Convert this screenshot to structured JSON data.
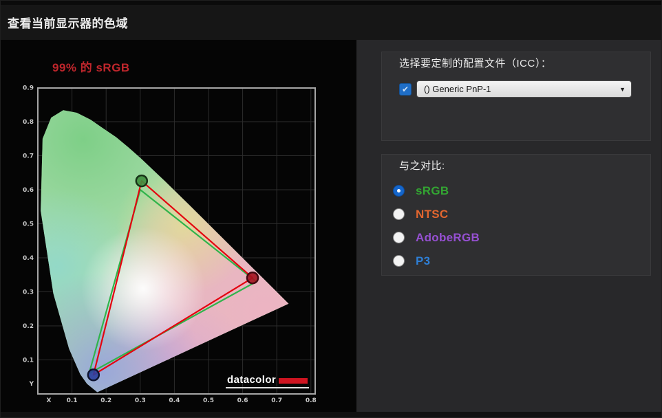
{
  "window": {
    "title": "查看当前显示器的色域"
  },
  "chart": {
    "gamut_label": "99% 的 sRGB",
    "gamut_label_color": "#c0262c",
    "logo_text": "datacolor",
    "logo_bar_color": "#cf1420"
  },
  "chart_data": {
    "type": "scatter",
    "subtype": "cie-1931-chromaticity-gamut",
    "title": "99% 的 sRGB",
    "xlabel": "X",
    "ylabel": "Y",
    "xlim": [
      0,
      0.8
    ],
    "ylim": [
      0,
      0.9
    ],
    "x_ticks": [
      "0.1",
      "0.2",
      "0.3",
      "0.4",
      "0.5",
      "0.6",
      "0.7",
      "0.8"
    ],
    "y_ticks": [
      "0.1",
      "0.2",
      "0.3",
      "0.4",
      "0.5",
      "0.6",
      "0.7",
      "0.8",
      "0.9"
    ],
    "grid": true,
    "legend": "none",
    "series": [
      {
        "name": "display-gamut",
        "shape": "triangle",
        "line_color": "#e4030f",
        "points": [
          [
            0.629,
            0.341
          ],
          [
            0.304,
            0.626
          ],
          [
            0.163,
            0.056
          ]
        ],
        "markers": [
          {
            "fill": "#a3121f",
            "ring": "#420810"
          },
          {
            "fill": "#3f8f3f",
            "ring": "#173317"
          },
          {
            "fill": "#2b3f9e",
            "ring": "#0e1430"
          }
        ]
      },
      {
        "name": "srgb-reference",
        "shape": "triangle",
        "line_color": "#2fb44b",
        "points": [
          [
            0.64,
            0.33
          ],
          [
            0.3,
            0.6
          ],
          [
            0.15,
            0.06
          ]
        ],
        "markers": []
      }
    ]
  },
  "icc_section": {
    "label": "选择要定制的配置文件（ICC）：",
    "checkbox_checked": true,
    "checkbox_color": "#1f6ec7",
    "check_glyph": "✔",
    "dropdown_value": "() Generic PnP-1",
    "dropdown_arrow": "▼"
  },
  "compare_section": {
    "label": "与之对比:",
    "options": [
      {
        "label": "sRGB",
        "color": "#33a532",
        "selected": true
      },
      {
        "label": "NTSC",
        "color": "#e2662f",
        "selected": false
      },
      {
        "label": "AdobeRGB",
        "color": "#9650d2",
        "selected": false
      },
      {
        "label": "P3",
        "color": "#2e7fd6",
        "selected": false
      }
    ]
  }
}
